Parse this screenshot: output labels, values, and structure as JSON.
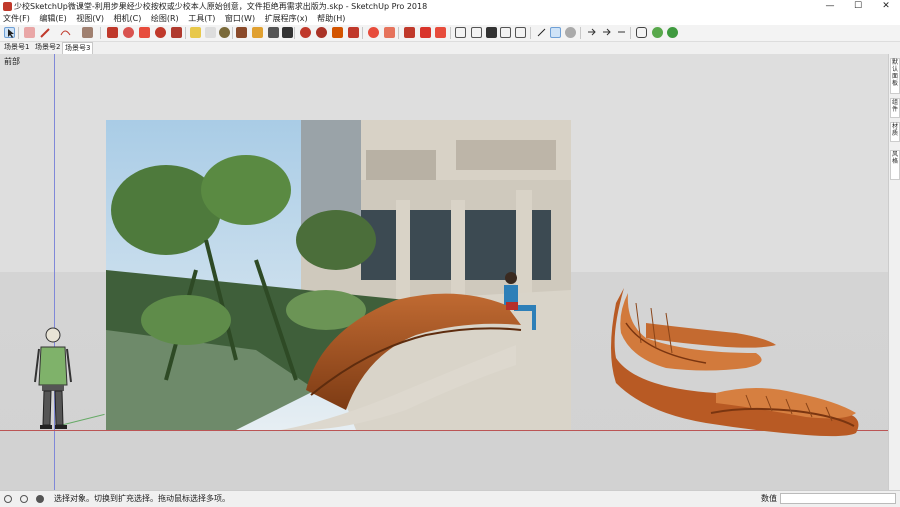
{
  "window": {
    "title": "少校SketchUp微课堂-利用步果经少校按权或少校本人原始创意，文件拒绝再需求出版为.skp - SketchUp Pro 2018",
    "controls": [
      "—",
      "☐",
      "✕"
    ]
  },
  "menu": [
    "文件(F)",
    "编辑(E)",
    "视图(V)",
    "相机(C)",
    "绘图(R)",
    "工具(T)",
    "窗口(W)",
    "扩展程序(x)",
    "帮助(H)"
  ],
  "scene_tabs": [
    "场景号1",
    "场景号2",
    "场景号3"
  ],
  "viewport": {
    "label": "前部"
  },
  "right_panel_tabs": [
    "默认面板",
    "组件",
    "材质",
    "风格"
  ],
  "status": {
    "message": "选择对象。切换到扩充选择。拖动鼠标选择多项。",
    "measure_label": "数值",
    "measure_value": ""
  },
  "colors": {
    "bench": "#c9692a",
    "bench_dark": "#8a4418",
    "axis_red": "#bb5555",
    "axis_blue": "#7f88d8",
    "axis_green": "#66aa66"
  },
  "icons": [
    "select-icon",
    "eraser-icon",
    "pencil-icon",
    "arc-icon",
    "shape-icon",
    "pushpull-icon",
    "move-icon",
    "rotate-icon",
    "scale-icon",
    "offset-icon",
    "tape-icon",
    "text-icon",
    "paint-icon",
    "orbit-icon",
    "pan-icon",
    "zoom-icon",
    "zoom-extents-icon",
    "warehouse-icon",
    "extension-icon",
    "section-icon",
    "layout-icon",
    "component-icon",
    "material-icon",
    "style-icon"
  ]
}
